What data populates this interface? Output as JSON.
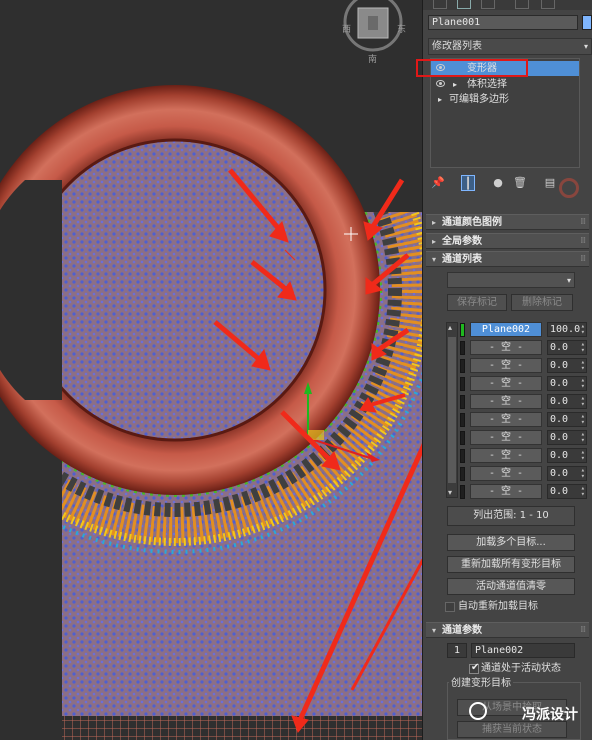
{
  "viewcube": {
    "left_label": "西",
    "right_label": "东",
    "bottom_label": "南"
  },
  "panel": {
    "object_name": "Plane001",
    "modifier_list_label": "修改器列表",
    "stack": [
      {
        "label": "变形器",
        "selected": true,
        "eye": true,
        "expand": ""
      },
      {
        "label": "体积选择",
        "selected": false,
        "eye": true,
        "expand": "▸"
      },
      {
        "label": "可编辑多边形",
        "selected": false,
        "eye": false,
        "expand": "▸"
      }
    ],
    "rollouts": {
      "channel_color_legend": "通道颜色图例",
      "global_params": "全局参数",
      "channel_list": "通道列表",
      "channel_params": "通道参数"
    },
    "buttons": {
      "save_marker": "保存标记",
      "delete_marker": "删除标记",
      "list_range": "列出范围:   1 - 10",
      "load_multiple": "加载多个目标...",
      "reload_all": "重新加载所有变形目标",
      "zero_active": "活动通道值清零",
      "pick_from_scene": "从场景中拾取",
      "capture_current": "捕获当前状态"
    },
    "auto_reload_label": "自动重新加载目标",
    "channels": [
      {
        "name": "Plane002",
        "value": "100.0",
        "active": true
      },
      {
        "name": "- 空 -",
        "value": "0.0",
        "active": false
      },
      {
        "name": "- 空 -",
        "value": "0.0",
        "active": false
      },
      {
        "name": "- 空 -",
        "value": "0.0",
        "active": false
      },
      {
        "name": "- 空 -",
        "value": "0.0",
        "active": false
      },
      {
        "name": "- 空 -",
        "value": "0.0",
        "active": false
      },
      {
        "name": "- 空 -",
        "value": "0.0",
        "active": false
      },
      {
        "name": "- 空 -",
        "value": "0.0",
        "active": false
      },
      {
        "name": "- 空 -",
        "value": "0.0",
        "active": false
      },
      {
        "name": "- 空 -",
        "value": "0.0",
        "active": false
      }
    ],
    "channel_params": {
      "index": "1",
      "name": "Plane002",
      "active_label": "通道处于活动状态",
      "create_target_label": "创建变形目标"
    }
  },
  "watermark": "冯派设计",
  "colors": {
    "torus": "#b5483a",
    "plane": "#8c6f86",
    "accent_red": "#f02a1a",
    "selection_blue": "#4f8fd6"
  }
}
